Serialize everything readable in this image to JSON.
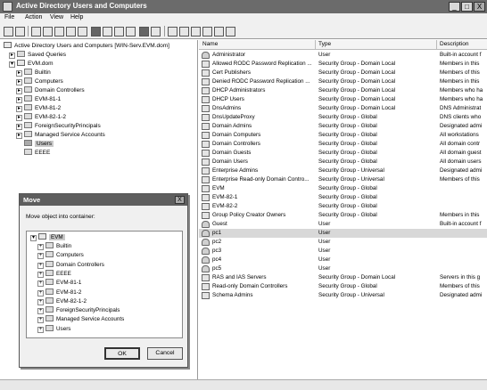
{
  "window": {
    "title": "Active Directory Users and Computers",
    "btn_minimize": "_",
    "btn_maximize": "□",
    "btn_close": "X"
  },
  "menu": {
    "items": [
      "File",
      "Action",
      "View",
      "Help"
    ]
  },
  "tree": {
    "root": "Active Directory Users and Computers [WIN-Serv.EVM.dom]",
    "saved_queries": "Saved Queries",
    "domain": "EVM.dom",
    "children": [
      "Builtin",
      "Computers",
      "Domain Controllers",
      "EVM-81-1",
      "EVM-81-2",
      "EVM-82-1-2",
      "ForeignSecurityPrincipals",
      "Managed Service Accounts",
      "Users",
      "EEEE"
    ],
    "selected": "Users"
  },
  "list": {
    "columns": [
      "Name",
      "Type",
      "Description"
    ],
    "rows": [
      {
        "name": "Administrator",
        "type": "User",
        "desc": "Built-in account f",
        "icon": "user-icon"
      },
      {
        "name": "Allowed RODC Password Replication ...",
        "type": "Security Group - Domain Local",
        "desc": "Members in this",
        "icon": "group-icon"
      },
      {
        "name": "Cert Publishers",
        "type": "Security Group - Domain Local",
        "desc": "Members of this",
        "icon": "group-icon"
      },
      {
        "name": "Denied RODC Password Replication ...",
        "type": "Security Group - Domain Local",
        "desc": "Members in this",
        "icon": "group-icon"
      },
      {
        "name": "DHCP Administrators",
        "type": "Security Group - Domain Local",
        "desc": "Members who ha",
        "icon": "group-icon"
      },
      {
        "name": "DHCP Users",
        "type": "Security Group - Domain Local",
        "desc": "Members who ha",
        "icon": "group-icon"
      },
      {
        "name": "DnsAdmins",
        "type": "Security Group - Domain Local",
        "desc": "DNS Administrat",
        "icon": "group-icon"
      },
      {
        "name": "DnsUpdateProxy",
        "type": "Security Group - Global",
        "desc": "DNS clients who",
        "icon": "group-icon"
      },
      {
        "name": "Domain Admins",
        "type": "Security Group - Global",
        "desc": "Designated admi",
        "icon": "group-icon"
      },
      {
        "name": "Domain Computers",
        "type": "Security Group - Global",
        "desc": "All workstations",
        "icon": "group-icon"
      },
      {
        "name": "Domain Controllers",
        "type": "Security Group - Global",
        "desc": "All domain contr",
        "icon": "group-icon"
      },
      {
        "name": "Domain Guests",
        "type": "Security Group - Global",
        "desc": "All domain guest",
        "icon": "group-icon"
      },
      {
        "name": "Domain Users",
        "type": "Security Group - Global",
        "desc": "All domain users",
        "icon": "group-icon"
      },
      {
        "name": "Enterprise Admins",
        "type": "Security Group - Universal",
        "desc": "Designated admi",
        "icon": "group-icon"
      },
      {
        "name": "Enterprise Read-only Domain Contro...",
        "type": "Security Group - Universal",
        "desc": "Members of this",
        "icon": "group-icon"
      },
      {
        "name": "EVM",
        "type": "Security Group - Global",
        "desc": "",
        "icon": "group-icon"
      },
      {
        "name": "EVM-82-1",
        "type": "Security Group - Global",
        "desc": "",
        "icon": "group-icon"
      },
      {
        "name": "EVM-82-2",
        "type": "Security Group - Global",
        "desc": "",
        "icon": "group-icon"
      },
      {
        "name": "Group Policy Creator Owners",
        "type": "Security Group - Global",
        "desc": "Members in this",
        "icon": "group-icon"
      },
      {
        "name": "Guest",
        "type": "User",
        "desc": "Built-in account f",
        "icon": "user-icon"
      },
      {
        "name": "pc1",
        "type": "User",
        "desc": "",
        "icon": "user-icon",
        "highlighted": true
      },
      {
        "name": "pc2",
        "type": "User",
        "desc": "",
        "icon": "user-icon"
      },
      {
        "name": "pc3",
        "type": "User",
        "desc": "",
        "icon": "user-icon"
      },
      {
        "name": "pc4",
        "type": "User",
        "desc": "",
        "icon": "user-icon"
      },
      {
        "name": "pc5",
        "type": "User",
        "desc": "",
        "icon": "user-icon"
      },
      {
        "name": "RAS and IAS Servers",
        "type": "Security Group - Domain Local",
        "desc": "Servers in this g",
        "icon": "group-icon"
      },
      {
        "name": "Read-only Domain Controllers",
        "type": "Security Group - Global",
        "desc": "Members of this",
        "icon": "group-icon"
      },
      {
        "name": "Schema Admins",
        "type": "Security Group - Universal",
        "desc": "Designated admi",
        "icon": "group-icon"
      }
    ]
  },
  "dialog": {
    "title": "Move",
    "close": "X",
    "prompt": "Move object into container:",
    "root": "EVM",
    "children": [
      "Builtin",
      "Computers",
      "Domain Controllers",
      "EEEE",
      "EVM-81-1",
      "EVM-81-2",
      "EVM-82-1-2",
      "ForeignSecurityPrincipals",
      "Managed Service Accounts",
      "Users"
    ],
    "ok": "OK",
    "cancel": "Cancel"
  }
}
